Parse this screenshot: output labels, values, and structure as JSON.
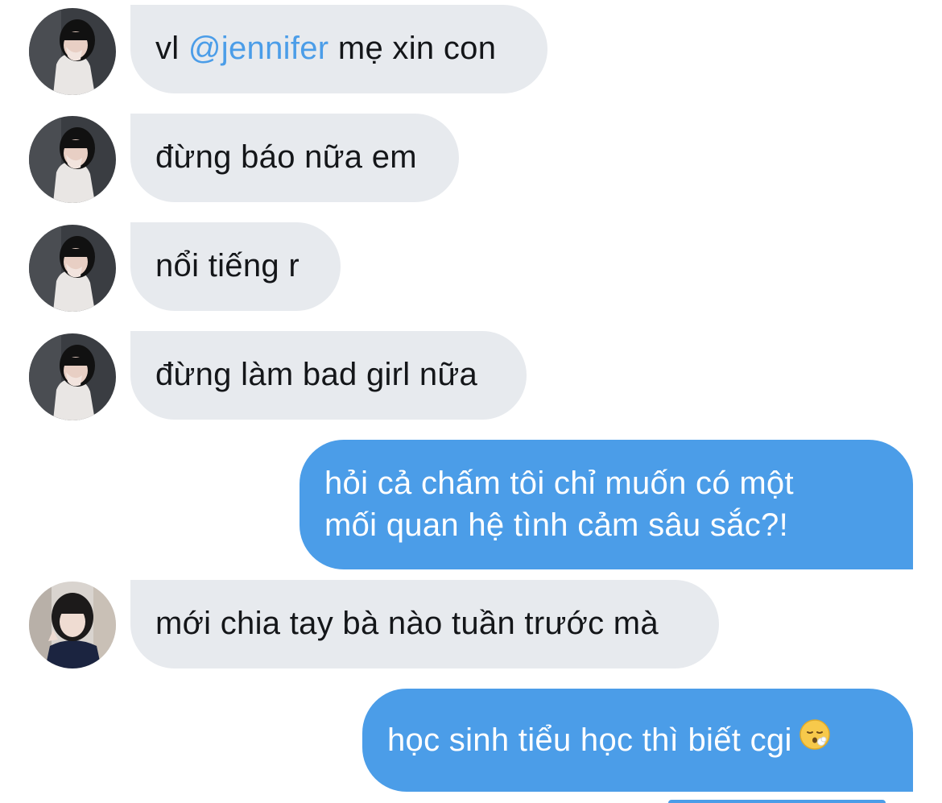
{
  "messages": [
    {
      "from": "them",
      "avatar": "avatar-girl-covering-face",
      "pre": "vl ",
      "mention": "@jennifer",
      "post": " mẹ xin con"
    },
    {
      "from": "them",
      "avatar": "avatar-girl-covering-face",
      "text": "đừng báo nữa em"
    },
    {
      "from": "them",
      "avatar": "avatar-girl-covering-face",
      "text": "nổi tiếng r"
    },
    {
      "from": "them",
      "avatar": "avatar-girl-covering-face",
      "text": "đừng làm bad girl nữa"
    },
    {
      "from": "me",
      "line1": "hỏi cả chấm tôi chỉ muốn có một",
      "line2": "mối quan hệ tình cảm sâu sắc?!"
    },
    {
      "from": "them",
      "avatar": "avatar-girl-winking",
      "text": "mới chia tay bà nào tuần trước mà"
    },
    {
      "from": "me",
      "text": "học sinh tiểu học thì biết cgi",
      "emoji": "face-exhaling-emoji"
    }
  ],
  "colors": {
    "incoming_bubble": "#e7eaee",
    "outgoing_bubble": "#4b9de8",
    "mention": "#4b9de8",
    "text_dark": "#141619",
    "text_light": "#ffffff"
  }
}
